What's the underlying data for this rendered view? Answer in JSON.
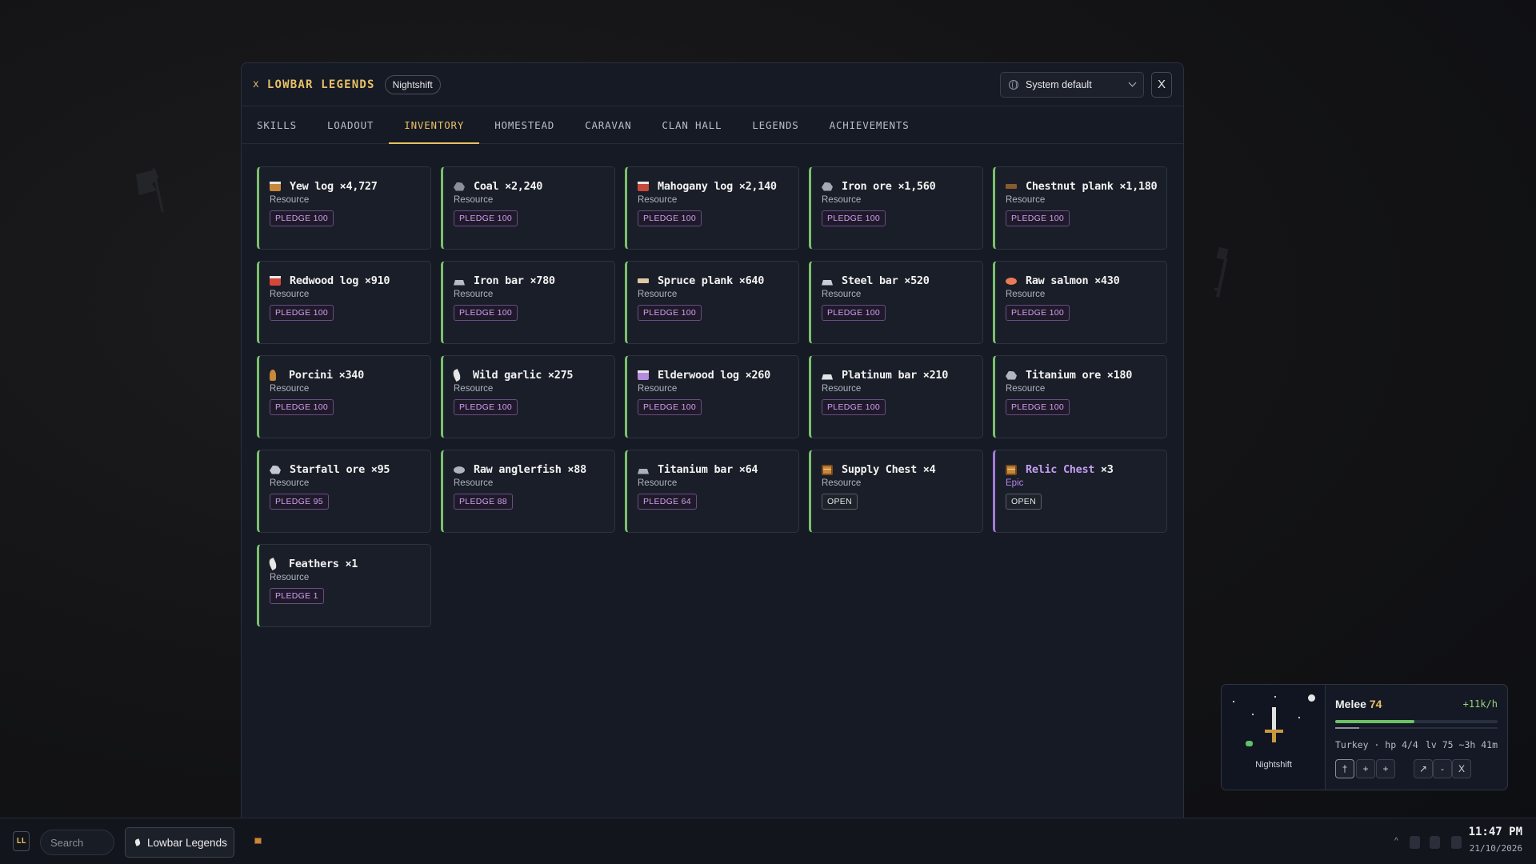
{
  "window": {
    "close_glyph": "x",
    "title": "LOWBAR LEGENDS",
    "badge": "Nightshift",
    "theme_select": {
      "value": "System default",
      "icon": "globe-icon"
    },
    "close_button": "X"
  },
  "tabs": [
    {
      "label": "SKILLS",
      "active": false
    },
    {
      "label": "LOADOUT",
      "active": false
    },
    {
      "label": "INVENTORY",
      "active": true
    },
    {
      "label": "HOMESTEAD",
      "active": false
    },
    {
      "label": "CARAVAN",
      "active": false
    },
    {
      "label": "CLAN HALL",
      "active": false
    },
    {
      "label": "LEGENDS",
      "active": false
    },
    {
      "label": "ACHIEVEMENTS",
      "active": false
    }
  ],
  "inventory": [
    {
      "name": "Yew log ×4,727",
      "category": "Resource",
      "action": "PLEDGE 100",
      "icon": "log-icon",
      "color": "#c8873b"
    },
    {
      "name": "Coal ×2,240",
      "category": "Resource",
      "action": "PLEDGE 100",
      "icon": "ore-icon",
      "color": "#8a8f99"
    },
    {
      "name": "Mahogany log ×2,140",
      "category": "Resource",
      "action": "PLEDGE 100",
      "icon": "log-icon",
      "color": "#c54a3c"
    },
    {
      "name": "Iron ore ×1,560",
      "category": "Resource",
      "action": "PLEDGE 100",
      "icon": "ore-icon",
      "color": "#a4a9b3"
    },
    {
      "name": "Chestnut plank ×1,180",
      "category": "Resource",
      "action": "PLEDGE 100",
      "icon": "plank-icon",
      "color": "#8a5a2e"
    },
    {
      "name": "Redwood log ×910",
      "category": "Resource",
      "action": "PLEDGE 100",
      "icon": "log-icon",
      "color": "#d4473a"
    },
    {
      "name": "Iron bar ×780",
      "category": "Resource",
      "action": "PLEDGE 100",
      "icon": "bar-icon",
      "color": "#b7bcc5"
    },
    {
      "name": "Spruce plank ×640",
      "category": "Resource",
      "action": "PLEDGE 100",
      "icon": "plank-icon",
      "color": "#e0c7a6"
    },
    {
      "name": "Steel bar ×520",
      "category": "Resource",
      "action": "PLEDGE 100",
      "icon": "bar-icon",
      "color": "#c9ced6"
    },
    {
      "name": "Raw salmon ×430",
      "category": "Resource",
      "action": "PLEDGE 100",
      "icon": "fish-icon",
      "color": "#e87b58"
    },
    {
      "name": "Porcini ×340",
      "category": "Resource",
      "action": "PLEDGE 100",
      "icon": "mushroom-icon",
      "color": "#c8873b"
    },
    {
      "name": "Wild garlic ×275",
      "category": "Resource",
      "action": "PLEDGE 100",
      "icon": "leaf-icon",
      "color": "#e6e6e6"
    },
    {
      "name": "Elderwood log ×260",
      "category": "Resource",
      "action": "PLEDGE 100",
      "icon": "log-icon",
      "color": "#b48be0"
    },
    {
      "name": "Platinum bar ×210",
      "category": "Resource",
      "action": "PLEDGE 100",
      "icon": "bar-icon",
      "color": "#e2e4e8"
    },
    {
      "name": "Titanium ore ×180",
      "category": "Resource",
      "action": "PLEDGE 100",
      "icon": "ore-icon",
      "color": "#b0b5bf"
    },
    {
      "name": "Starfall ore ×95",
      "category": "Resource",
      "action": "PLEDGE 95",
      "icon": "ore-icon",
      "color": "#c2c7d0"
    },
    {
      "name": "Raw anglerfish ×88",
      "category": "Resource",
      "action": "PLEDGE 88",
      "icon": "fish-icon",
      "color": "#aeb3bd"
    },
    {
      "name": "Titanium bar ×64",
      "category": "Resource",
      "action": "PLEDGE 64",
      "icon": "bar-icon",
      "color": "#aab0ba"
    },
    {
      "name": "Supply Chest ×4",
      "category": "Resource",
      "action": "OPEN",
      "icon": "chest-icon",
      "color": "#c8873b"
    },
    {
      "name": "Relic Chest ×3",
      "category": "Epic",
      "action": "OPEN",
      "icon": "chest-icon",
      "color": "#c8873b",
      "rarity": "epic",
      "name_main": "Relic Chest",
      "name_count": " ×3"
    },
    {
      "name": "Feathers ×1",
      "category": "Resource",
      "action": "PLEDGE 1",
      "icon": "feather-icon",
      "color": "#e6e6e6"
    }
  ],
  "widget": {
    "character": "Nightshift",
    "skill": "Melee",
    "level": "74",
    "rate": "+11k/h",
    "xp_progress": 0.49,
    "sub_progress": 0.15,
    "status": "Turkey · hp 4/4",
    "level_eta": "lv 75 ~3h 41m",
    "buttons": [
      {
        "name": "sword-tool-button",
        "glyph": "†",
        "selected": true
      },
      {
        "name": "add-button-1",
        "glyph": "+"
      },
      {
        "name": "add-button-2",
        "glyph": "+"
      },
      {
        "name": "expand-button",
        "glyph": "↗"
      },
      {
        "name": "minimize-button",
        "glyph": "-"
      },
      {
        "name": "close-widget-button",
        "glyph": "X"
      }
    ]
  },
  "taskbar": {
    "logo": "LL",
    "search_placeholder": "Search",
    "app_label": "Lowbar Legends",
    "time": "11:47 PM",
    "date": "21/10/2026"
  }
}
